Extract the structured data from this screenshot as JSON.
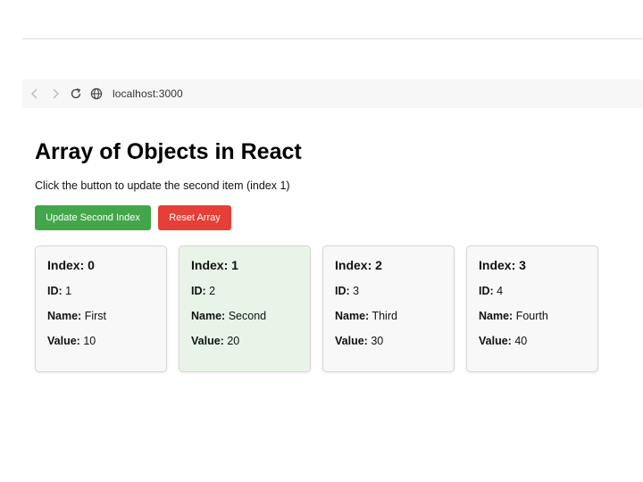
{
  "browser": {
    "url": "localhost:3000"
  },
  "page": {
    "title": "Array of Objects in React",
    "subtitle": "Click the button to update the second item (index 1)"
  },
  "buttons": {
    "update_label": "Update Second Index",
    "reset_label": "Reset Array"
  },
  "labels": {
    "index": "Index:",
    "id": "ID:",
    "name": "Name:",
    "value": "Value:"
  },
  "items": [
    {
      "index": "0",
      "id": "1",
      "name": "First",
      "value": "10",
      "highlighted": false
    },
    {
      "index": "1",
      "id": "2",
      "name": "Second",
      "value": "20",
      "highlighted": true
    },
    {
      "index": "2",
      "id": "3",
      "name": "Third",
      "value": "30",
      "highlighted": false
    },
    {
      "index": "3",
      "id": "4",
      "name": "Fourth",
      "value": "40",
      "highlighted": false
    }
  ],
  "colors": {
    "update_button": "#44a64a",
    "reset_button": "#e53f37",
    "card_background": "#f8f8f8",
    "highlighted_card_background": "#e8f4e8"
  }
}
